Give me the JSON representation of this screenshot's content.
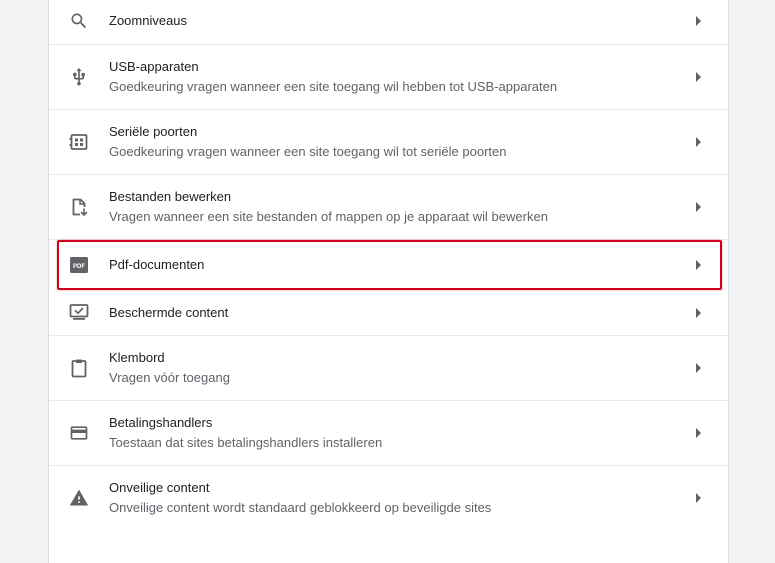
{
  "settings_list": [
    {
      "title": "Zoomniveaus",
      "subtitle": "",
      "icon": "search-icon"
    },
    {
      "title": "USB-apparaten",
      "subtitle": "Goedkeuring vragen wanneer een site toegang wil hebben tot USB-apparaten",
      "icon": "usb-icon"
    },
    {
      "title": "Seriële poorten",
      "subtitle": "Goedkeuring vragen wanneer een site toegang wil tot seriële poorten",
      "icon": "serial-port-icon"
    },
    {
      "title": "Bestanden bewerken",
      "subtitle": "Vragen wanneer een site bestanden of mappen op je apparaat wil bewerken",
      "icon": "file-edit-icon"
    },
    {
      "title": "Pdf-documenten",
      "subtitle": "",
      "icon": "pdf-icon",
      "icon_text": "PDF"
    },
    {
      "title": "Beschermde content",
      "subtitle": "",
      "icon": "protected-content-icon"
    },
    {
      "title": "Klembord",
      "subtitle": "Vragen vóór toegang",
      "icon": "clipboard-icon"
    },
    {
      "title": "Betalingshandlers",
      "subtitle": "Toestaan dat sites betalingshandlers installeren",
      "icon": "credit-card-icon"
    },
    {
      "title": "Onveilige content",
      "subtitle": "Onveilige content wordt standaard geblokkeerd op beveiligde sites",
      "icon": "warning-icon"
    }
  ],
  "colors": {
    "highlight": "#d0021b",
    "icon": "#5f6368",
    "title": "#202124",
    "subtitle": "#5f6368"
  }
}
